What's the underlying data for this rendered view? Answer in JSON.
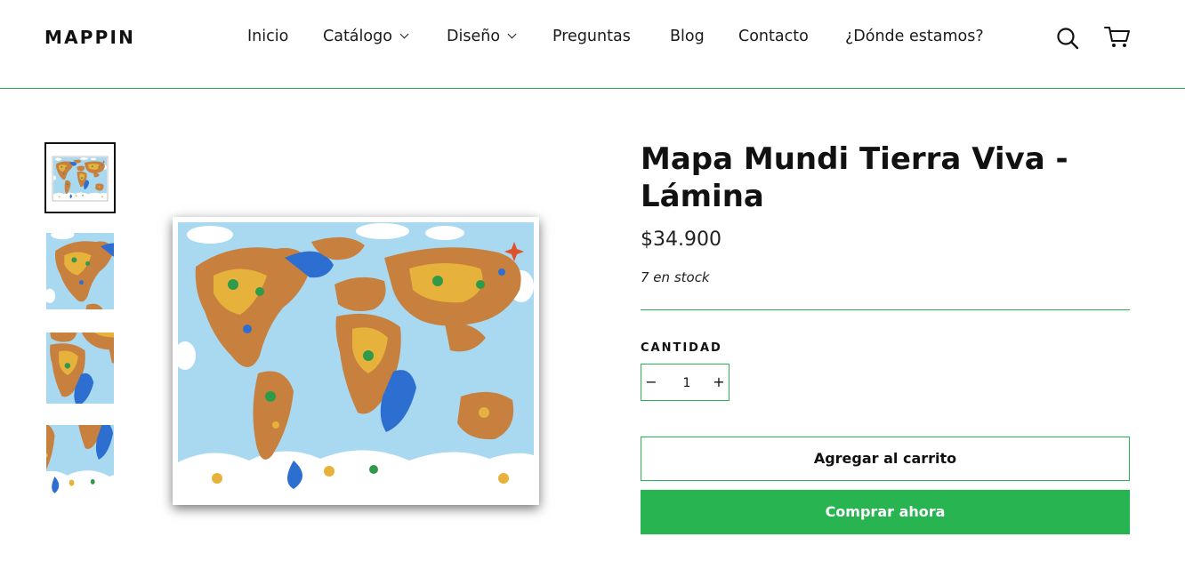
{
  "header": {
    "logo": "MAPPIN",
    "nav": [
      {
        "label": "Inicio",
        "dropdown": false
      },
      {
        "label": "Catálogo",
        "dropdown": true
      },
      {
        "label": "Diseño",
        "dropdown": true
      },
      {
        "label": "Preguntas",
        "dropdown": false
      },
      {
        "label": "Blog",
        "dropdown": false
      },
      {
        "label": "Contacto",
        "dropdown": false
      },
      {
        "label": "¿Dónde estamos?",
        "dropdown": false
      }
    ],
    "icons": [
      "search-icon",
      "cart-icon"
    ]
  },
  "product": {
    "title": "Mapa Mundi Tierra Viva - Lámina",
    "price": "$34.900",
    "stock": "7 en stock",
    "quantity_label": "CANTIDAD",
    "quantity": "1",
    "decrement": "−",
    "increment": "+",
    "add_to_cart": "Agregar al carrito",
    "buy_now": "Comprar ahora"
  },
  "colors": {
    "accent": "#27b451",
    "ocean": "#a8d8f0",
    "land": "#c8803f",
    "text": "#111111"
  }
}
